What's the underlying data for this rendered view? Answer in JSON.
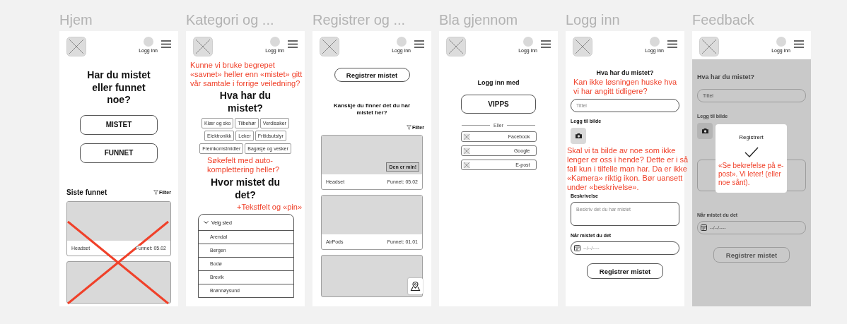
{
  "frames": [
    {
      "title": "Hjem",
      "kind": "home",
      "login": "Logg inn",
      "heading": "Har du mistet eller funnet noe?",
      "buttons": [
        "MISTET",
        "FUNNET"
      ],
      "section_title": "Siste funnet",
      "filter": "Filter",
      "cards": [
        {
          "name": "Headset",
          "date": "Funnet: 05.02"
        }
      ],
      "crossed_out": true
    },
    {
      "title": "Kategori og ...",
      "kind": "category",
      "login": "Logg inn",
      "heading": "Hva har du mistet?",
      "chips": [
        "Klær og sko",
        "Tilbehør",
        "Verdisaker",
        "Elektronikk",
        "Leker",
        "Fritidsutstyr",
        "Fremkomstmidler",
        "Bagasje og vesker"
      ],
      "heading2": "Hvor mistet du det?",
      "dropdown": {
        "label": "Velg sted",
        "options": [
          "Arendal",
          "Bergen",
          "Bodø",
          "Brevik",
          "Brønnøysund"
        ]
      },
      "notes": [
        "Kunne vi bruke begrepet «savnet» heller enn «mistet» gitt vår samtale i forrige veiledning?",
        "Søkefelt med auto-komplettering heller?",
        "+Tekstfelt og «pin»"
      ]
    },
    {
      "title": "Registrer og ...",
      "kind": "results",
      "login": "Logg inn",
      "action": "Registrer mistet",
      "heading": "Kanskje du finner det du har mistet her?",
      "filter": "Filter",
      "cards": [
        {
          "name": "Headset",
          "date": "Funnet: 05.02",
          "claim": "Den er min!"
        },
        {
          "name": "AirPods",
          "date": "Funnet: 01.01"
        }
      ]
    },
    {
      "title": "Bla gjennom",
      "kind": "login",
      "login": "Logg inn",
      "heading": "Logg inn med",
      "primary": "VIPPS",
      "divider": "Eller",
      "options": [
        "Facebook",
        "Google",
        "E-post"
      ]
    },
    {
      "title": "Logg inn",
      "kind": "form",
      "login": "Logg inn",
      "heading": "Hva har du mistet?",
      "title_placeholder": "Tittel",
      "photo_label": "Legg til bilde",
      "description_label": "Beskrivelse",
      "description_placeholder": "Beskriv det du har mistet",
      "date_label": "Når mistet du det",
      "date_placeholder": "--/--/----",
      "submit": "Registrer mistet",
      "dimmed": false,
      "notes": [
        "Kan ikke løsningen huske hva vi har angitt tidligere?",
        "Skal vi ta bilde av noe som ikke lenger er oss i hende? Dette er i så fall kun i tilfelle man har. Da er ikke «Kamera» riktig ikon. Bør uansett under «beskrivelse»."
      ]
    },
    {
      "title": "Feedback",
      "kind": "form",
      "login": "Logg inn",
      "heading": "Hva har du mistet?",
      "title_placeholder": "Tittel",
      "photo_label": "Legg til bilde",
      "date_label": "Når mistet du det",
      "date_placeholder": "--/--/----",
      "submit": "Registrer mistet",
      "dimmed": true,
      "modal": {
        "title": "Registrert"
      },
      "notes": [
        "«Se bekrefelse på e-post». Vi leter! (eller noe sånt)."
      ]
    }
  ]
}
